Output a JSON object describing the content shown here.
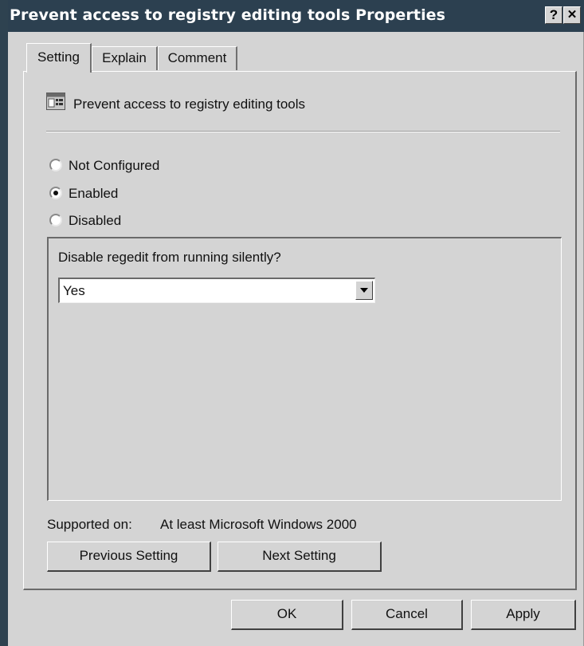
{
  "window": {
    "title": "Prevent access to registry editing tools Properties",
    "help_btn": "?",
    "close_btn": "✕"
  },
  "tabs": [
    {
      "label": "Setting",
      "active": true
    },
    {
      "label": "Explain",
      "active": false
    },
    {
      "label": "Comment",
      "active": false
    }
  ],
  "policy": {
    "name": "Prevent access to registry editing tools",
    "icon": "policy-setting-icon"
  },
  "state": {
    "options": [
      {
        "label": "Not Configured",
        "selected": false
      },
      {
        "label": "Enabled",
        "selected": true
      },
      {
        "label": "Disabled",
        "selected": false
      }
    ]
  },
  "options_box": {
    "question": "Disable regedit from running silently?",
    "select_value": "Yes"
  },
  "supported": {
    "label": "Supported on:",
    "value": "At least Microsoft Windows 2000"
  },
  "nav": {
    "previous": "Previous Setting",
    "next": "Next Setting"
  },
  "footer": {
    "ok": "OK",
    "cancel": "Cancel",
    "apply": "Apply"
  }
}
